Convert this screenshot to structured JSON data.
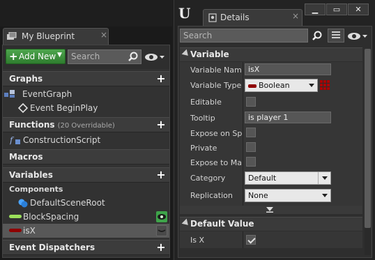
{
  "my_blueprint": {
    "tab_label": "My Blueprint",
    "toolbar": {
      "add_new_label": "Add New",
      "search_placeholder": "Search"
    },
    "sections": {
      "graphs": "Graphs",
      "functions": "Functions",
      "functions_note": "(20 Overridable)",
      "macros": "Macros",
      "variables": "Variables",
      "event_dispatchers": "Event Dispatchers"
    },
    "graphs_items": {
      "event_graph": "EventGraph",
      "begin_play": "Event BeginPlay"
    },
    "functions_items": {
      "construction_script": "ConstructionScript"
    },
    "variables_items": {
      "components_header": "Components",
      "default_scene_root": "DefaultSceneRoot",
      "block_spacing": "BlockSpacing",
      "is_x": "isX"
    },
    "colors": {
      "boolean": "#8f0000",
      "float": "#9be05a",
      "component": "#4aa4ff"
    }
  },
  "details": {
    "tab_label": "Details",
    "search_placeholder": "Search",
    "variable_section": "Variable",
    "default_value_section": "Default Value",
    "properties": {
      "variable_name_label": "Variable Name",
      "variable_name_value": "isX",
      "variable_type_label": "Variable Type",
      "variable_type_value": "Boolean",
      "editable_label": "Editable",
      "editable_checked": false,
      "tooltip_label": "Tooltip",
      "tooltip_value": "is player 1",
      "expose_on_spawn_label": "Expose on Spawn",
      "expose_on_spawn_checked": false,
      "private_label": "Private",
      "private_checked": false,
      "expose_to_matinee_label": "Expose to Matinee",
      "expose_to_matinee_checked": false,
      "category_label": "Category",
      "category_value": "Default",
      "replication_label": "Replication",
      "replication_value": "None"
    },
    "default_value": {
      "is_x_label": "Is X",
      "is_x_checked": true
    }
  }
}
